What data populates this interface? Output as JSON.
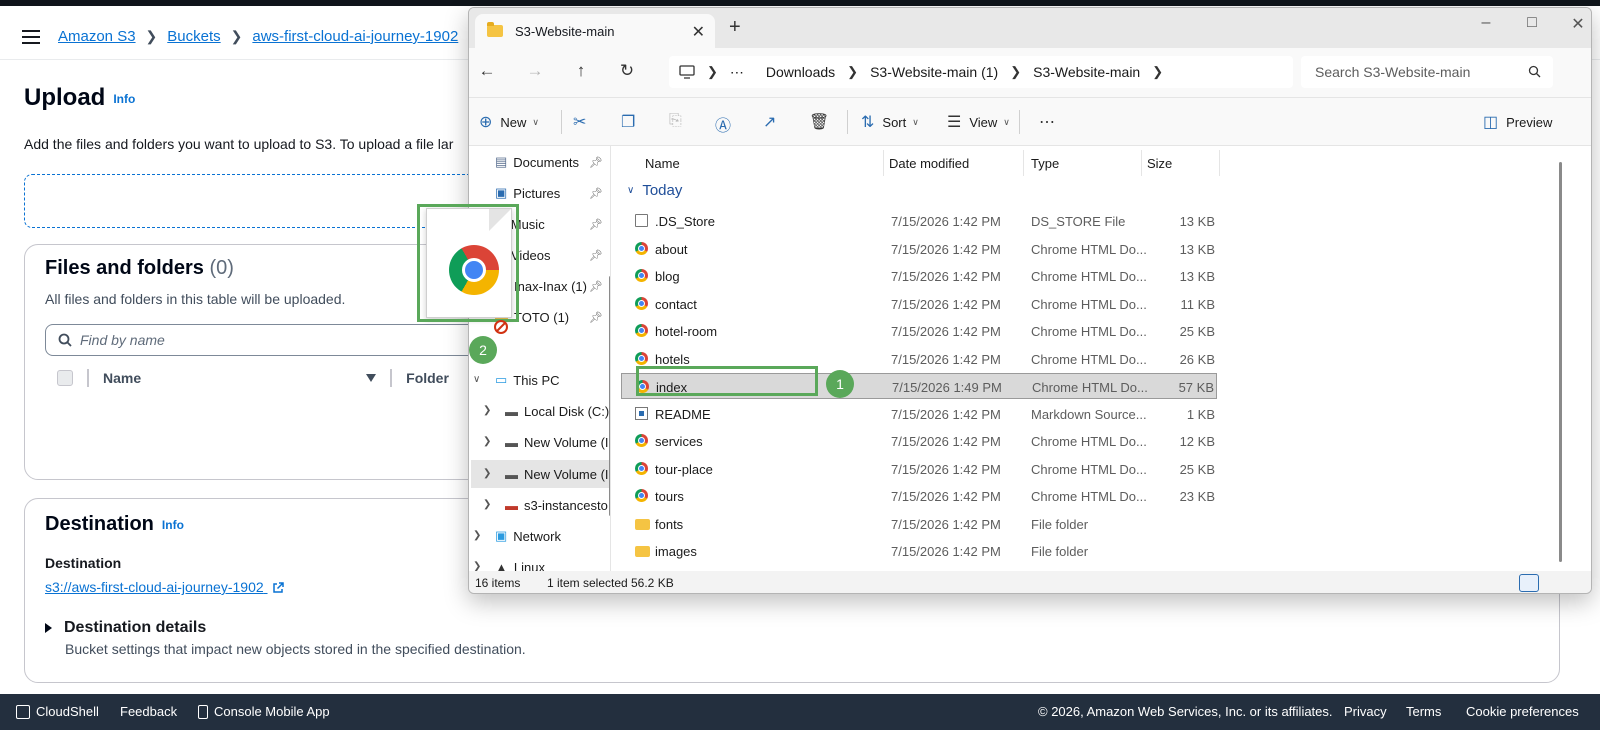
{
  "aws": {
    "breadcrumbs": [
      "Amazon S3",
      "Buckets",
      "aws-first-cloud-ai-journey-1902"
    ],
    "upload_title": "Upload",
    "info_label": "Info",
    "upload_desc": "Add the files and folders you want to upload to S3. To upload a file lar",
    "files_title": "Files and folders",
    "files_count": "(0)",
    "files_sub": "All files and folders in this table will be uploaded.",
    "find_placeholder": "Find by name",
    "col_name": "Name",
    "col_folder": "Folder",
    "dest_title": "Destination",
    "dest_label": "Destination",
    "dest_link": "s3://aws-first-cloud-ai-journey-1902",
    "details_title": "Destination details",
    "details_sub": "Bucket settings that impact new objects stored in the specified destination.",
    "footer": {
      "cloudshell": "CloudShell",
      "feedback": "Feedback",
      "mobile": "Console Mobile App",
      "copyright": "© 2026, Amazon Web Services, Inc. or its affiliates.",
      "privacy": "Privacy",
      "terms": "Terms",
      "cookies": "Cookie preferences"
    }
  },
  "explorer": {
    "tab_title": "S3-Website-main",
    "address": [
      "Downloads",
      "S3-Website-main (1)",
      "S3-Website-main"
    ],
    "search_placeholder": "Search S3-Website-main",
    "commands": {
      "new": "New",
      "sort": "Sort",
      "view": "View",
      "preview": "Preview"
    },
    "nav": [
      {
        "label": "Documents"
      },
      {
        "label": "Pictures"
      },
      {
        "label": "Music"
      },
      {
        "label": "Videos"
      },
      {
        "label": "Inax-Inax (1)"
      },
      {
        "label": "TOTO (1)"
      },
      {
        "label": "This PC"
      },
      {
        "label": "Local Disk (C:)"
      },
      {
        "label": "New Volume (I"
      },
      {
        "label": "New Volume (I"
      },
      {
        "label": "s3-instancesto"
      },
      {
        "label": "Network"
      },
      {
        "label": "Linux"
      }
    ],
    "columns": {
      "name": "Name",
      "date": "Date modified",
      "type": "Type",
      "size": "Size"
    },
    "group": "Today",
    "files": [
      {
        "name": ".DS_Store",
        "date": "7/15/2026 1:42 PM",
        "type": "DS_STORE File",
        "size": "13 KB",
        "icon": "doc-icon"
      },
      {
        "name": "about",
        "date": "7/15/2026 1:42 PM",
        "type": "Chrome HTML Do...",
        "size": "13 KB",
        "icon": "chrome-icon"
      },
      {
        "name": "blog",
        "date": "7/15/2026 1:42 PM",
        "type": "Chrome HTML Do...",
        "size": "13 KB",
        "icon": "chrome-icon"
      },
      {
        "name": "contact",
        "date": "7/15/2026 1:42 PM",
        "type": "Chrome HTML Do...",
        "size": "11 KB",
        "icon": "chrome-icon"
      },
      {
        "name": "hotel-room",
        "date": "7/15/2026 1:42 PM",
        "type": "Chrome HTML Do...",
        "size": "25 KB",
        "icon": "chrome-icon"
      },
      {
        "name": "hotels",
        "date": "7/15/2026 1:42 PM",
        "type": "Chrome HTML Do...",
        "size": "26 KB",
        "icon": "chrome-icon"
      },
      {
        "name": "index",
        "date": "7/15/2026 1:49 PM",
        "type": "Chrome HTML Do...",
        "size": "57 KB",
        "icon": "chrome-icon",
        "selected": true
      },
      {
        "name": "README",
        "date": "7/15/2026 1:42 PM",
        "type": "Markdown Source...",
        "size": "1 KB",
        "icon": "markdown-icon"
      },
      {
        "name": "services",
        "date": "7/15/2026 1:42 PM",
        "type": "Chrome HTML Do...",
        "size": "12 KB",
        "icon": "chrome-icon"
      },
      {
        "name": "tour-place",
        "date": "7/15/2026 1:42 PM",
        "type": "Chrome HTML Do...",
        "size": "25 KB",
        "icon": "chrome-icon"
      },
      {
        "name": "tours",
        "date": "7/15/2026 1:42 PM",
        "type": "Chrome HTML Do...",
        "size": "23 KB",
        "icon": "chrome-icon"
      },
      {
        "name": "fonts",
        "date": "7/15/2026 1:42 PM",
        "type": "File folder",
        "size": "",
        "icon": "folder-icon"
      },
      {
        "name": "images",
        "date": "7/15/2026 1:42 PM",
        "type": "File folder",
        "size": "",
        "icon": "folder-icon"
      }
    ],
    "status": {
      "items": "16 items",
      "selected": "1 item selected",
      "size": "56.2 KB"
    }
  },
  "annotations": {
    "step1": "1",
    "step2": "2"
  },
  "colors": {
    "aws_link": "#0972d3",
    "footer_bg": "#232f3e",
    "annotation": "#5aa85a"
  }
}
